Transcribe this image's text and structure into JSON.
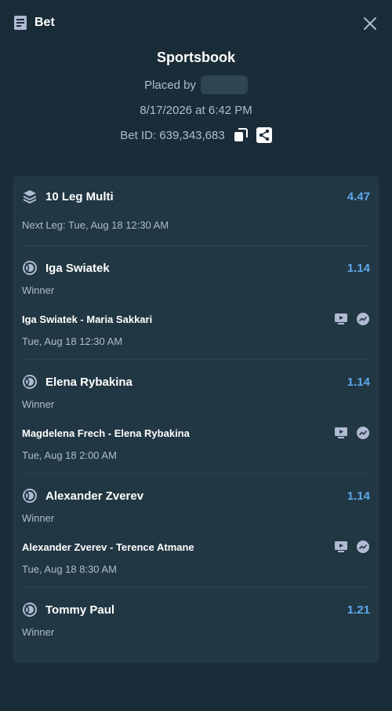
{
  "header": {
    "title": "Bet"
  },
  "summary": {
    "provider": "Sportsbook",
    "placed_by_label": "Placed by",
    "date": "8/17/2026 at 6:42 PM",
    "bet_id_label": "Bet ID: 639,343,683"
  },
  "multi": {
    "label": "10 Leg Multi",
    "odds": "4.47",
    "next_leg": "Next Leg: Tue, Aug 18 12:30 AM"
  },
  "legs": [
    {
      "name": "Iga Swiatek",
      "odds": "1.14",
      "market": "Winner",
      "event": "Iga Swiatek - Maria Sakkari",
      "time": "Tue, Aug 18  12:30 AM"
    },
    {
      "name": "Elena Rybakina",
      "odds": "1.14",
      "market": "Winner",
      "event": "Magdelena Frech - Elena Rybakina",
      "time": "Tue, Aug 18  2:00 AM"
    },
    {
      "name": "Alexander Zverev",
      "odds": "1.14",
      "market": "Winner",
      "event": "Alexander Zverev - Terence Atmane",
      "time": "Tue, Aug 18  8:30 AM"
    },
    {
      "name": "Tommy Paul",
      "odds": "1.21",
      "market": "Winner",
      "event": "",
      "time": ""
    }
  ],
  "colors": {
    "background": "#1a2c38",
    "card": "#213743",
    "odds": "#5da8ea",
    "muted": "#b1bad3"
  }
}
